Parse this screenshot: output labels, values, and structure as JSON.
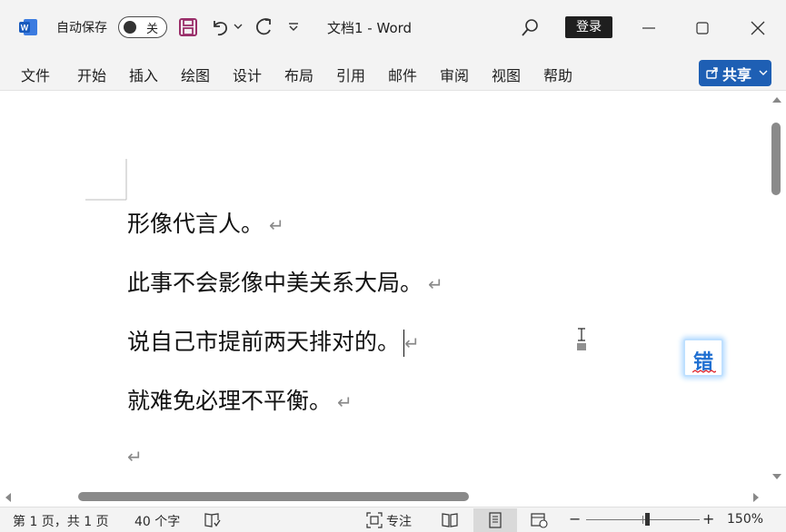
{
  "titlebar": {
    "autosave_label": "自动保存",
    "autosave_state": "关",
    "document_title": "文档1  -  Word",
    "login_label": "登录"
  },
  "ribbon": {
    "tabs": [
      "文件",
      "开始",
      "插入",
      "绘图",
      "设计",
      "布局",
      "引用",
      "邮件",
      "审阅",
      "视图",
      "帮助"
    ],
    "share_label": "共享"
  },
  "document": {
    "lines": [
      "形像代言人。",
      "此事不会影像中美关系大局。",
      "说自己市提前两天排对的。",
      "就难免必理不平衡。",
      ""
    ],
    "spell_badge": "错"
  },
  "statusbar": {
    "page_info": "第 1 页，共 1 页",
    "word_count": "40 个字",
    "focus_label": "专注",
    "zoom_minus": "−",
    "zoom_plus": "+",
    "zoom_level": "150%"
  },
  "colors": {
    "accent": "#1e5fb4",
    "chrome_bg": "#f3f3f3",
    "spell_badge_glow": "#b6dcff"
  }
}
